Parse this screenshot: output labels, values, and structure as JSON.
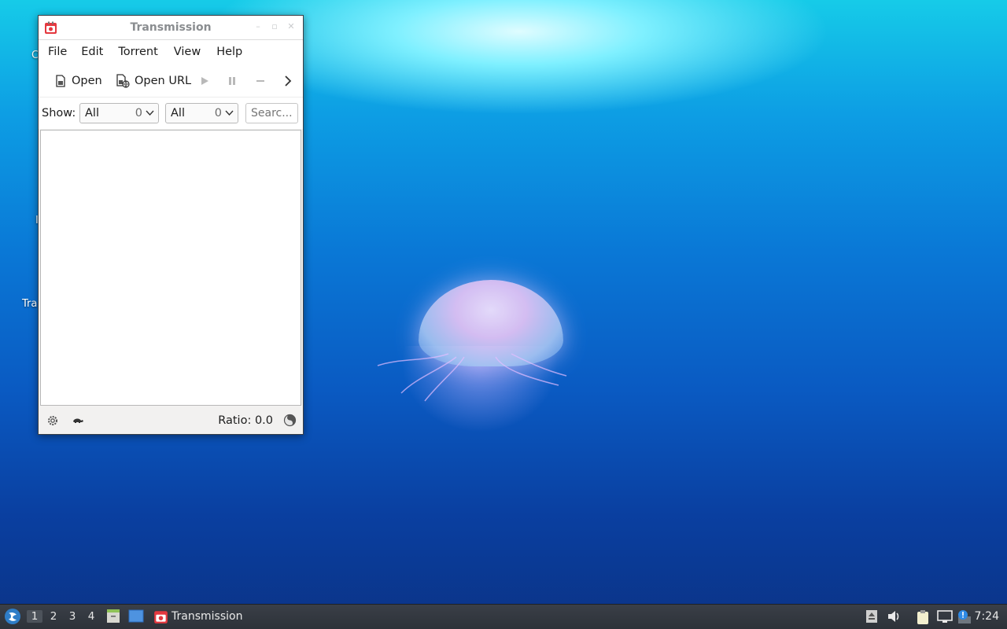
{
  "desktop": {
    "labels": [
      "C",
      "I",
      "Tra"
    ]
  },
  "window": {
    "title": "Transmission",
    "menu": [
      "File",
      "Edit",
      "Torrent",
      "View",
      "Help"
    ],
    "toolbar": {
      "open_label": "Open",
      "open_url_label": "Open URL"
    },
    "filter": {
      "show_label": "Show:",
      "activity": {
        "value": "All",
        "count": "0"
      },
      "tracker": {
        "value": "All",
        "count": "0"
      },
      "search_placeholder": "Searc..."
    },
    "status": {
      "ratio": "Ratio: 0.0"
    }
  },
  "taskbar": {
    "workspaces": [
      "1",
      "2",
      "3",
      "4"
    ],
    "active_workspace": "1",
    "task_label": "Transmission",
    "clock": "7:24"
  }
}
